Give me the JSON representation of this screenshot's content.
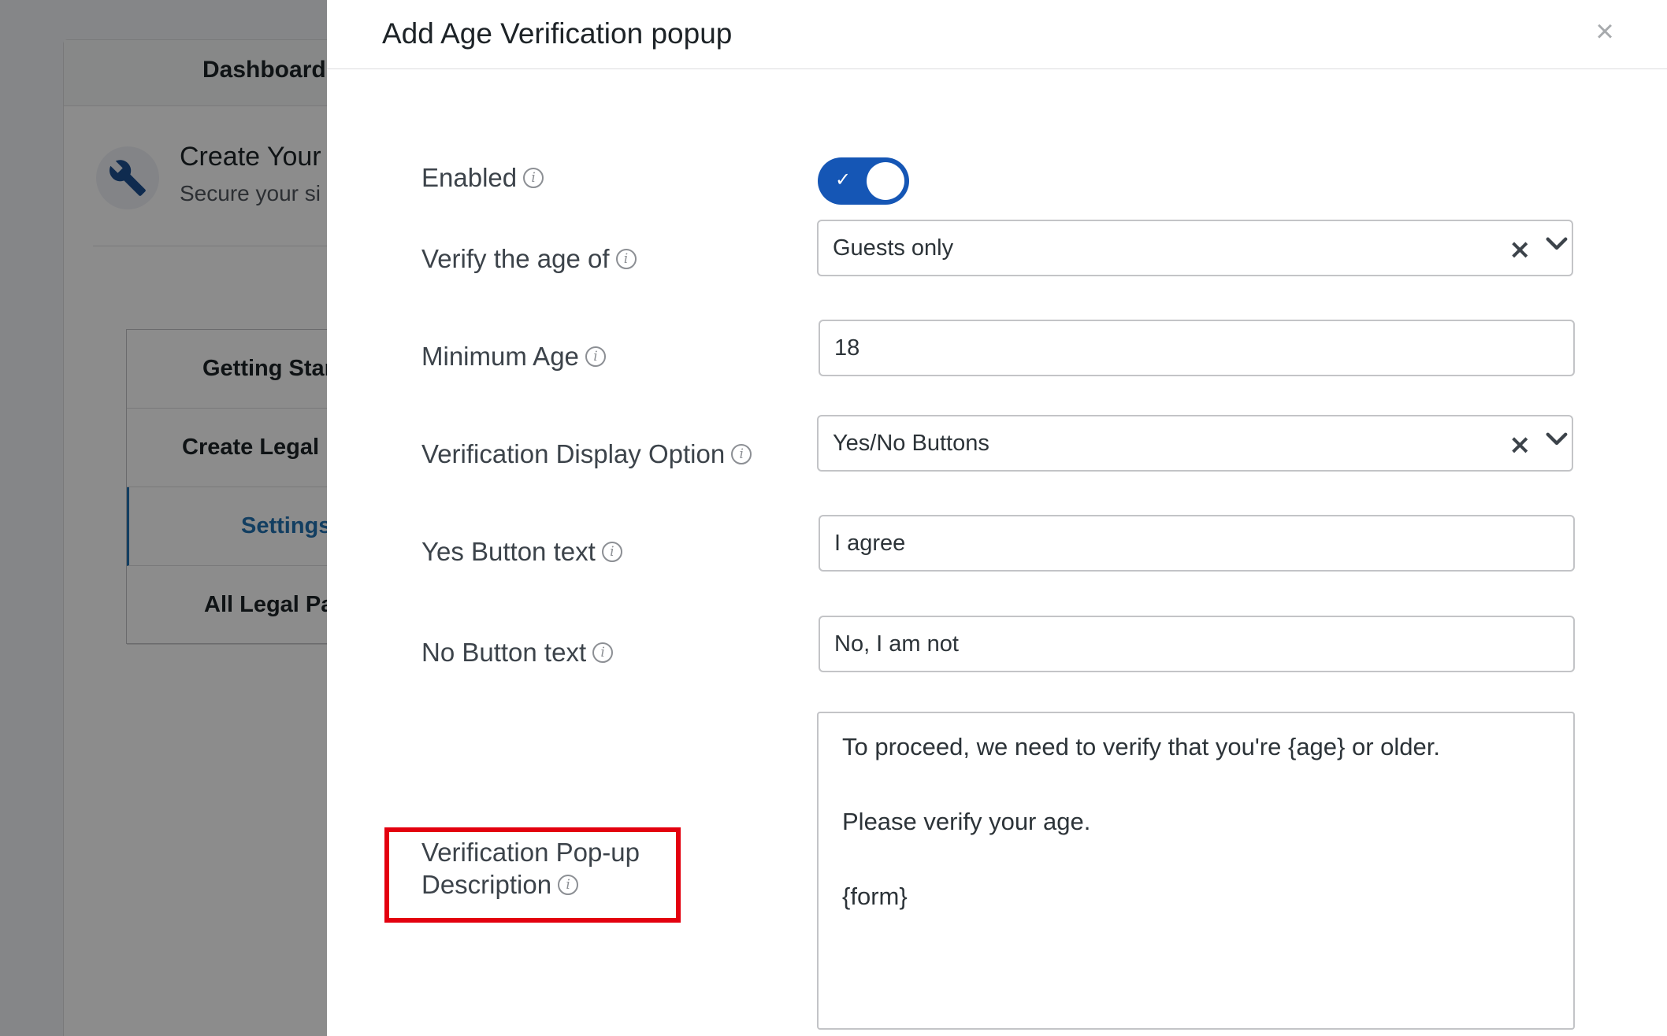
{
  "background": {
    "dashboard_tab": "Dashboard",
    "create_title": "Create Your l",
    "create_subtitle": "Secure your si",
    "nav": [
      "Getting Star",
      "Create Legal P",
      "Settings",
      "All Legal Pa"
    ]
  },
  "modal": {
    "title": "Add Age Verification popup",
    "close_glyph": "×"
  },
  "fields": {
    "enabled": {
      "label": "Enabled",
      "value": true
    },
    "verify_age_of": {
      "label": "Verify the age of",
      "value": "Guests only"
    },
    "minimum_age": {
      "label": "Minimum Age",
      "value": "18"
    },
    "display_option": {
      "label": "Verification Display Option",
      "value": "Yes/No Buttons"
    },
    "yes_button": {
      "label": "Yes Button text",
      "value": "I agree"
    },
    "no_button": {
      "label": "No Button text",
      "value": "No, I am not"
    },
    "description": {
      "label_line1": "Verification Pop-up",
      "label_line2": "Description",
      "lines": [
        "To proceed, we need to verify that you're {age} or older.",
        "Please verify your age.",
        "{form}"
      ]
    }
  },
  "icons": {
    "info": "info-icon",
    "clear": "×",
    "check": "✓"
  },
  "colors": {
    "toggle_on": "#1556b5",
    "highlight": "#e3000f",
    "active_nav": "#2271b1"
  }
}
